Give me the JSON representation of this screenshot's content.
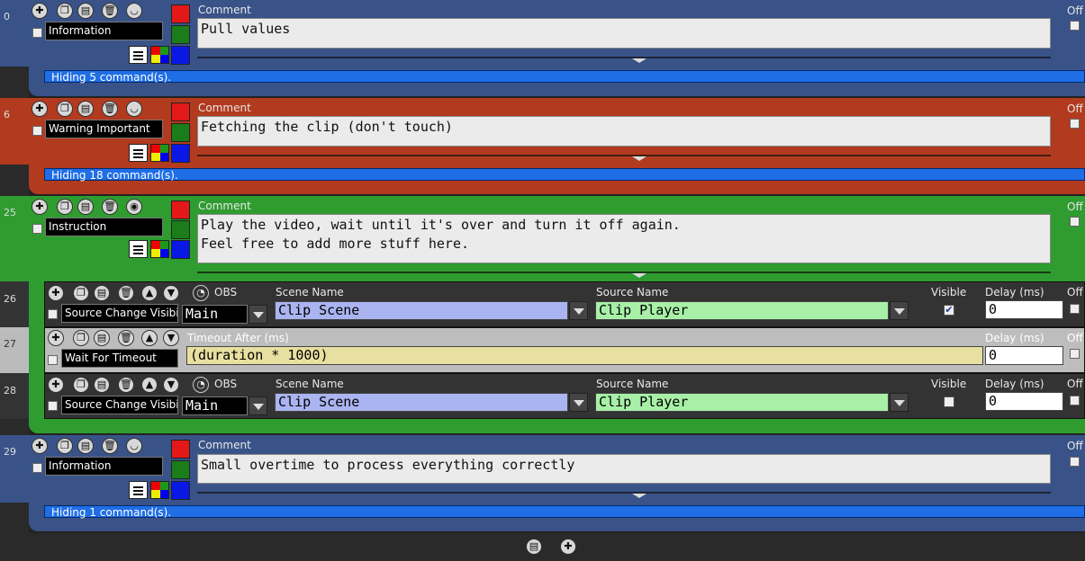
{
  "groups": [
    {
      "row": "0",
      "tag": "Information",
      "comment_label": "Comment",
      "comment": "Pull values",
      "off_label": "Off",
      "hiding": "Hiding 5 command(s)."
    },
    {
      "row": "6",
      "tag": "Warning Important",
      "comment_label": "Comment",
      "comment": "Fetching the clip (don't touch)",
      "off_label": "Off",
      "hiding": "Hiding 18 command(s)."
    },
    {
      "row": "25",
      "tag": "Instruction",
      "comment_label": "Comment",
      "comment": "Play the video, wait until it's over and turn it off again.\nFeel free to add more stuff here.",
      "off_label": "Off"
    },
    {
      "row": "29",
      "tag": "Information",
      "comment_label": "Comment",
      "comment": "Small overtime to process everything correctly",
      "off_label": "Off",
      "hiding": "Hiding 1 command(s)."
    }
  ],
  "commands": [
    {
      "row": "26",
      "tag": "Source Change Visibili",
      "obs": "OBS",
      "scene_label": "Scene Name",
      "scene": "Main",
      "scene_value": "Clip Scene",
      "source_label": "Source Name",
      "source_value": "Clip Player",
      "visible_label": "Visible",
      "visible_checked": true,
      "delay_label": "Delay (ms)",
      "delay": "0",
      "off_label": "Off"
    },
    {
      "row": "27",
      "tag": "Wait For Timeout",
      "timeout_label": "Timeout After (ms)",
      "timeout": "(duration * 1000)",
      "delay_label": "Delay (ms)",
      "delay": "0",
      "off_label": "Off"
    },
    {
      "row": "28",
      "tag": "Source Change Visibili",
      "obs": "OBS",
      "scene_label": "Scene Name",
      "scene": "Main",
      "scene_value": "Clip Scene",
      "source_label": "Source Name",
      "source_value": "Clip Player",
      "visible_label": "Visible",
      "visible_checked": false,
      "delay_label": "Delay (ms)",
      "delay": "0",
      "off_label": "Off"
    }
  ],
  "colors": {
    "blue_group": "#395388",
    "red_group": "#b23a1e",
    "green_group": "#2f9c2f",
    "hiding_bar": "#1f6ee6",
    "scene_field": "#aab4f0",
    "source_field": "#a8f0a8",
    "timeout_field": "#e8e0a0"
  },
  "icons": [
    "add-icon",
    "copy-icon",
    "paste-icon",
    "delete-icon",
    "collapse-icon",
    "move-up-icon",
    "move-down-icon",
    "obs-logo-icon",
    "menu-icon",
    "palette-icon"
  ],
  "footer": {
    "icons": [
      "paste-icon",
      "add-icon"
    ]
  }
}
